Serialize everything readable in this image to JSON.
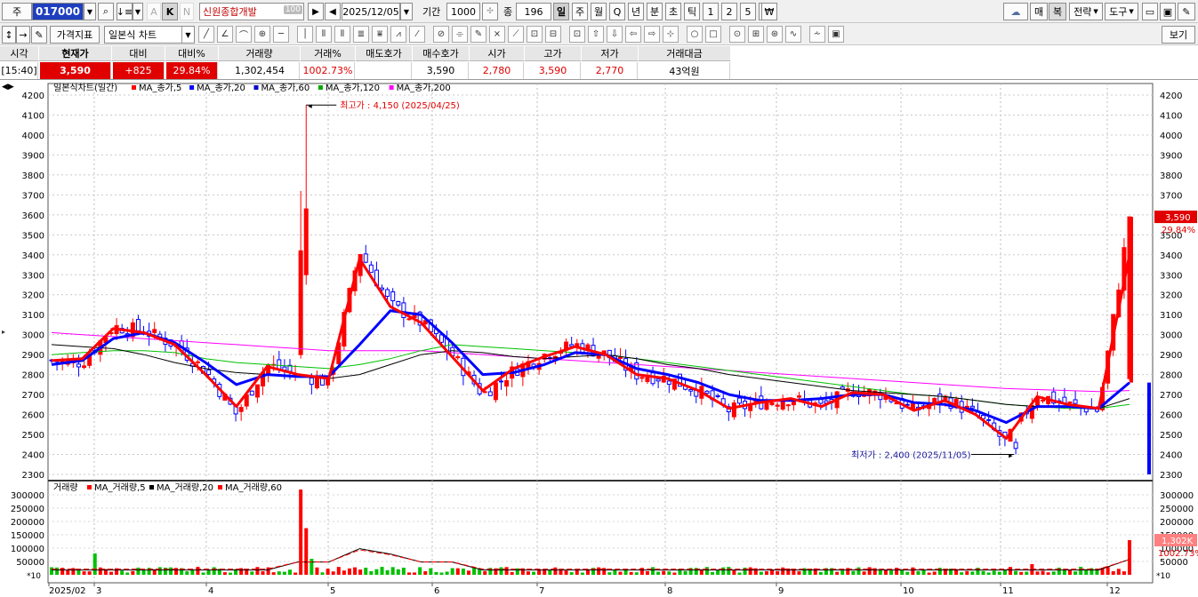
{
  "toolbar": {
    "market_label": "주",
    "stock_code": "017000",
    "stock_name": "신원종합개발",
    "stock_name_badge": "100",
    "date": "2025/12/05",
    "period_label": "기간",
    "period_value": "1000",
    "count_label": "종",
    "count_value": "196",
    "k_label": "K",
    "a_label": "A",
    "n_label": "N",
    "periods": [
      "일",
      "주",
      "월",
      "Q",
      "년",
      "분",
      "초",
      "틱",
      "1",
      "2",
      "5",
      "15"
    ],
    "right_buttons": [
      "매",
      "복",
      "전략",
      "도구"
    ],
    "view_label": "보기",
    "indicator_label": "가격지표",
    "chart_type": "일본식 차트"
  },
  "quote": {
    "headers": [
      "시각",
      "현재가",
      "대비",
      "대비%",
      "거래량",
      "거래%",
      "매도호가",
      "매수호가",
      "시가",
      "고가",
      "저가",
      "거래대금"
    ],
    "values": [
      "[15:40]",
      "3,590",
      "+825",
      "29.84%",
      "1,302,454",
      "1002.73%",
      "",
      "3,590",
      "2,780",
      "3,590",
      "2,770",
      "43억원"
    ]
  },
  "chart": {
    "title": "일본식차트(일간)",
    "ma_legend": [
      {
        "label": "MA_종가,5",
        "color": "#ff0000"
      },
      {
        "label": "MA_종가,20",
        "color": "#0000ff"
      },
      {
        "label": "MA_종가,60",
        "color": "#0000cc"
      },
      {
        "label": "MA_종가,120",
        "color": "#00aa00"
      },
      {
        "label": "MA_종가,200",
        "color": "#ff00ff"
      }
    ],
    "high_note": "최고가 : 4,150 (2025/04/25)",
    "low_note": "최저가 : 2,400 (2025/11/05)",
    "price_ticks": [
      "4200",
      "4100",
      "4000",
      "3900",
      "3800",
      "3700",
      "3600",
      "3500",
      "3400",
      "3300",
      "3200",
      "3100",
      "3000",
      "2900",
      "2800",
      "2700",
      "2600",
      "2500",
      "2400",
      "2300"
    ],
    "last_price": "3,590",
    "last_pct": "29.84%",
    "volume_title": "거래량",
    "volume_legend": [
      {
        "label": "MA_거래량,5",
        "color": "#ff0000"
      },
      {
        "label": "MA_거래량,20",
        "color": "#000000"
      },
      {
        "label": "MA_거래량,60",
        "color": "#ff0000"
      }
    ],
    "volume_ticks": [
      "300000",
      "250000",
      "200000",
      "150000",
      "100000",
      "50000"
    ],
    "volume_unit": "*10",
    "last_volume": "1,302K",
    "last_volume_pct": "1002.73%",
    "months": [
      "2025/02",
      "3",
      "4",
      "5",
      "6",
      "7",
      "8",
      "9",
      "10",
      "11",
      "12"
    ]
  },
  "chart_data": {
    "type": "candlestick",
    "title": "일본식차트(일간)",
    "ylim": [
      2300,
      4200
    ],
    "volume_ylim": [
      0,
      330000
    ],
    "x": [
      "2025/02",
      "3",
      "4",
      "5",
      "6",
      "7",
      "8",
      "9",
      "10",
      "11",
      "12"
    ],
    "close_approx": [
      2870,
      2860,
      3040,
      3020,
      2950,
      2820,
      2600,
      2850,
      2800,
      2760,
      3420,
      3150,
      3060,
      2900,
      2700,
      2820,
      2900,
      2950,
      2900,
      2800,
      2780,
      2720,
      2620,
      2660,
      2680,
      2640,
      2720,
      2700,
      2620,
      2680,
      2600,
      2460,
      2700,
      2650,
      2620,
      3590
    ],
    "series": [
      {
        "name": "MA_종가,5",
        "values": [
          2870,
          2880,
          3030,
          3010,
          2950,
          2800,
          2640,
          2840,
          2800,
          2780,
          3380,
          3140,
          3060,
          2890,
          2720,
          2830,
          2890,
          2940,
          2900,
          2800,
          2780,
          2720,
          2630,
          2660,
          2680,
          2640,
          2710,
          2700,
          2620,
          2670,
          2600,
          2480,
          2690,
          2650,
          2630,
          3400
        ]
      },
      {
        "name": "MA_종가,20",
        "values": [
          2850,
          2870,
          2980,
          3010,
          2960,
          2860,
          2750,
          2800,
          2790,
          2790,
          2950,
          3120,
          3100,
          2960,
          2800,
          2810,
          2850,
          2910,
          2900,
          2830,
          2800,
          2760,
          2700,
          2670,
          2670,
          2680,
          2700,
          2700,
          2660,
          2650,
          2620,
          2560,
          2640,
          2640,
          2630,
          2760
        ]
      },
      {
        "name": "MA_종가,60",
        "values": [
          2950,
          2940,
          2930,
          2900,
          2860,
          2830,
          2810,
          2800,
          2790,
          2780,
          2800,
          2850,
          2900,
          2920,
          2910,
          2890,
          2880,
          2890,
          2900,
          2880,
          2850,
          2830,
          2800,
          2780,
          2760,
          2740,
          2720,
          2710,
          2700,
          2690,
          2670,
          2650,
          2640,
          2640,
          2630,
          2680
        ]
      },
      {
        "name": "MA_종가,120",
        "values": [
          2900,
          2910,
          2920,
          2920,
          2910,
          2880,
          2860,
          2850,
          2840,
          2830,
          2850,
          2880,
          2920,
          2950,
          2940,
          2930,
          2920,
          2910,
          2900,
          2880,
          2860,
          2840,
          2820,
          2800,
          2780,
          2760,
          2740,
          2720,
          2700,
          2690,
          2670,
          2650,
          2640,
          2630,
          2630,
          2650
        ]
      },
      {
        "name": "MA_종가,200",
        "values": [
          3010,
          3000,
          2990,
          2980,
          2970,
          2960,
          2950,
          2940,
          2930,
          2920,
          2920,
          2920,
          2920,
          2910,
          2900,
          2890,
          2880,
          2870,
          2860,
          2850,
          2840,
          2830,
          2820,
          2810,
          2800,
          2790,
          2780,
          2770,
          2760,
          2750,
          2740,
          2730,
          2725,
          2720,
          2715,
          2720
        ]
      }
    ]
  }
}
